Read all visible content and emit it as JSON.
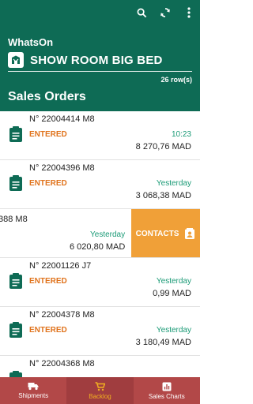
{
  "header": {
    "app_name": "WhatsOn",
    "store_name": "SHOW ROOM BIG BED",
    "row_count": "26 row(s)",
    "section_title": "Sales Orders",
    "icons": [
      "search-icon",
      "refresh-icon",
      "more-vert-icon",
      "store-icon"
    ]
  },
  "orders": [
    {
      "number": "N° 22004414 M8",
      "status": "ENTERED",
      "date": "10:23",
      "amount": "8 270,76 MAD"
    },
    {
      "number": "N° 22004396 M8",
      "status": "ENTERED",
      "date": "Yesterday",
      "amount": "3 068,38 MAD"
    },
    {
      "number": "388 M8",
      "status": "",
      "date": "Yesterday",
      "amount": "6 020,80 MAD"
    },
    {
      "number": "N° 22001126 J7",
      "status": "ENTERED",
      "date": "Yesterday",
      "amount": "0,99 MAD"
    },
    {
      "number": "N° 22004378 M8",
      "status": "ENTERED",
      "date": "Yesterday",
      "amount": "3 180,49 MAD"
    },
    {
      "number": "N° 22004368 M8",
      "status": "",
      "date": "",
      "amount": ""
    }
  ],
  "swipe_action": {
    "label": "CONTACTS",
    "icon": "contact-card-icon"
  },
  "bottom_nav": [
    {
      "label": "Shipments",
      "icon": "truck-icon",
      "active": false
    },
    {
      "label": "Backlog",
      "icon": "cart-icon",
      "active": true
    },
    {
      "label": "Sales Charts",
      "icon": "bar-chart-icon",
      "active": false
    }
  ],
  "colors": {
    "primary": "#0e6b55",
    "status_entered": "#e0731c",
    "date_green": "#1a9a76",
    "swipe_action": "#f0a038",
    "bottom_nav": "#b24848",
    "nav_active_label": "#f2b020"
  }
}
